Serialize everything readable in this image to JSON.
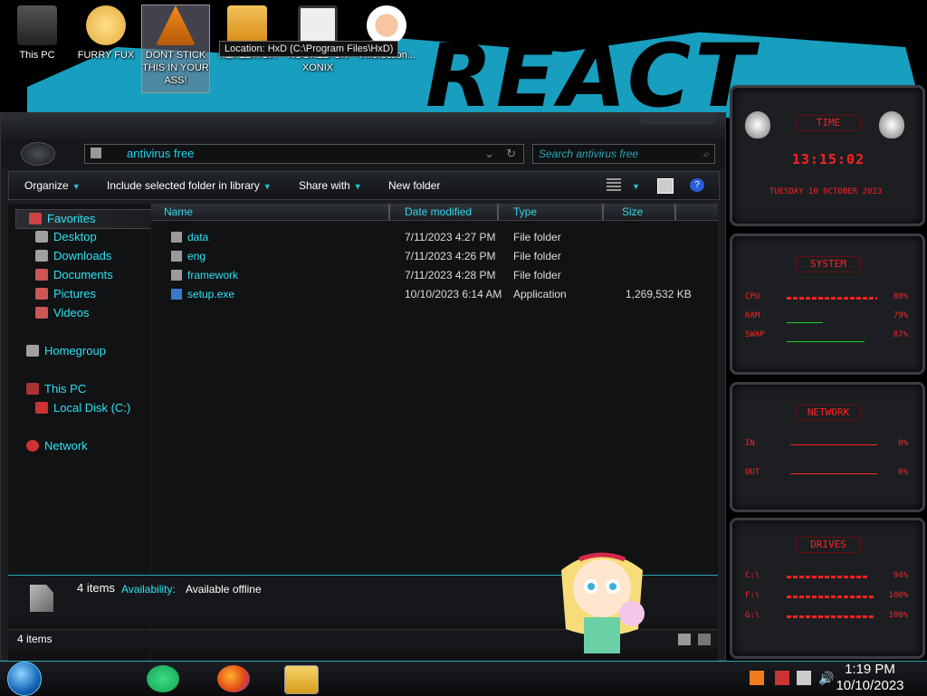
{
  "desktop": {
    "icons": [
      {
        "label": "This PC"
      },
      {
        "label": "FURRY FUX"
      },
      {
        "label": "DONT STICK THIS IN YOUR ASS!"
      },
      {
        "label": "HEXEDITOR"
      },
      {
        "label": "HOOKED ON XONIX"
      },
      {
        "label": "VMofection..."
      }
    ],
    "tooltip": "Location: HxD (C:\\Program Files\\HxD)",
    "wallpaper_text": "REACT"
  },
  "explorer": {
    "address": "antivirus free",
    "search_placeholder": "Search antivirus free",
    "toolbar": {
      "organize": "Organize",
      "include": "Include selected folder in library",
      "share": "Share with",
      "new_folder": "New folder"
    },
    "nav": {
      "favorites": "Favorites",
      "desktop": "Desktop",
      "downloads": "Downloads",
      "documents": "Documents",
      "pictures": "Pictures",
      "videos": "Videos",
      "homegroup": "Homegroup",
      "this_pc": "This PC",
      "local_disk": "Local Disk (C:)",
      "network": "Network"
    },
    "columns": {
      "name": "Name",
      "date": "Date modified",
      "type": "Type",
      "size": "Size"
    },
    "files": [
      {
        "name": "data",
        "date": "7/11/2023 4:27 PM",
        "type": "File folder",
        "size": ""
      },
      {
        "name": "eng",
        "date": "7/11/2023 4:26 PM",
        "type": "File folder",
        "size": ""
      },
      {
        "name": "framework",
        "date": "7/11/2023 4:28 PM",
        "type": "File folder",
        "size": ""
      },
      {
        "name": "setup.exe",
        "date": "10/10/2023 6:14 AM",
        "type": "Application",
        "size": "1,269,532 KB"
      }
    ],
    "details": {
      "count": "4 items",
      "availability_label": "Availability:",
      "availability_value": "Available offline"
    },
    "status": "4 items"
  },
  "gadgets": {
    "time": {
      "title": "TIME",
      "clock": "13:15:02",
      "date": "TUESDAY 10 OCTOBER 2023"
    },
    "system": {
      "title": "SYSTEM",
      "cpu_label": "CPU",
      "cpu_value": "80%",
      "ram_label": "RAM",
      "ram_value": "79%",
      "swap_label": "SWAP",
      "swap_value": "87%"
    },
    "network": {
      "title": "NETWORK",
      "in_label": "IN",
      "in_value": "0%",
      "out_label": "OUT",
      "out_value": "0%"
    },
    "drives": {
      "title": "DRIVES",
      "d1_label": "C:\\",
      "d1_value": "94%",
      "d2_label": "F:\\",
      "d2_value": "100%",
      "d3_label": "G:\\",
      "d3_value": "100%"
    }
  },
  "taskbar": {
    "time": "1:19 PM",
    "date": "10/10/2023"
  },
  "colors": {
    "accent": "#2ee3f2",
    "gadget_red": "#ff2222",
    "wall_cyan": "#19a6c8"
  }
}
